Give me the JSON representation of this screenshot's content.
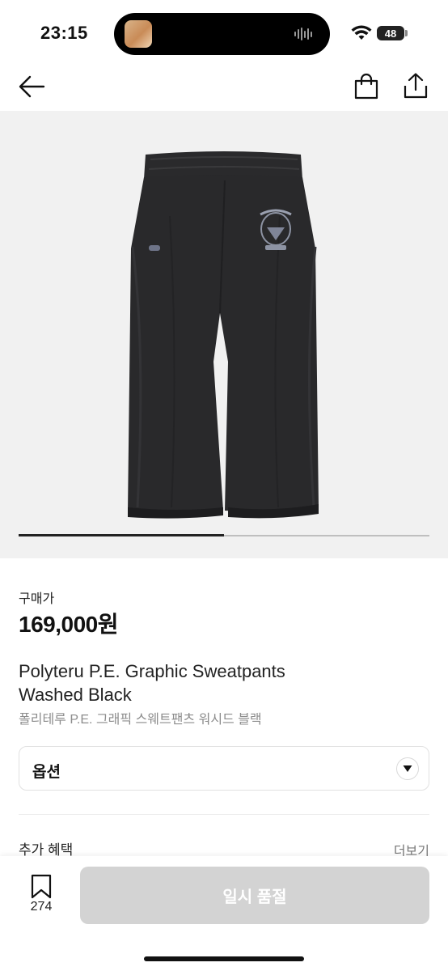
{
  "status_bar": {
    "time": "23:15",
    "battery": "48"
  },
  "product": {
    "price_label": "구매가",
    "price": "169,000원",
    "title_en": "Polyteru P.E. Graphic Sweatpants\nWashed Black",
    "title_ko": "폴리테루 P.E. 그래픽 스웨트팬츠 워시드 블랙",
    "image_progress": 0.5
  },
  "options": {
    "label": "옵션"
  },
  "benefits": {
    "title": "추가 혜택",
    "more": "더보기"
  },
  "bottom": {
    "wish_count": "274",
    "action_label": "일시 품절"
  },
  "icons": [
    "back-arrow-icon",
    "shopping-bag-icon",
    "share-icon",
    "dropdown-arrow-icon",
    "bookmark-icon",
    "wifi-icon",
    "audio-wave-icon"
  ]
}
